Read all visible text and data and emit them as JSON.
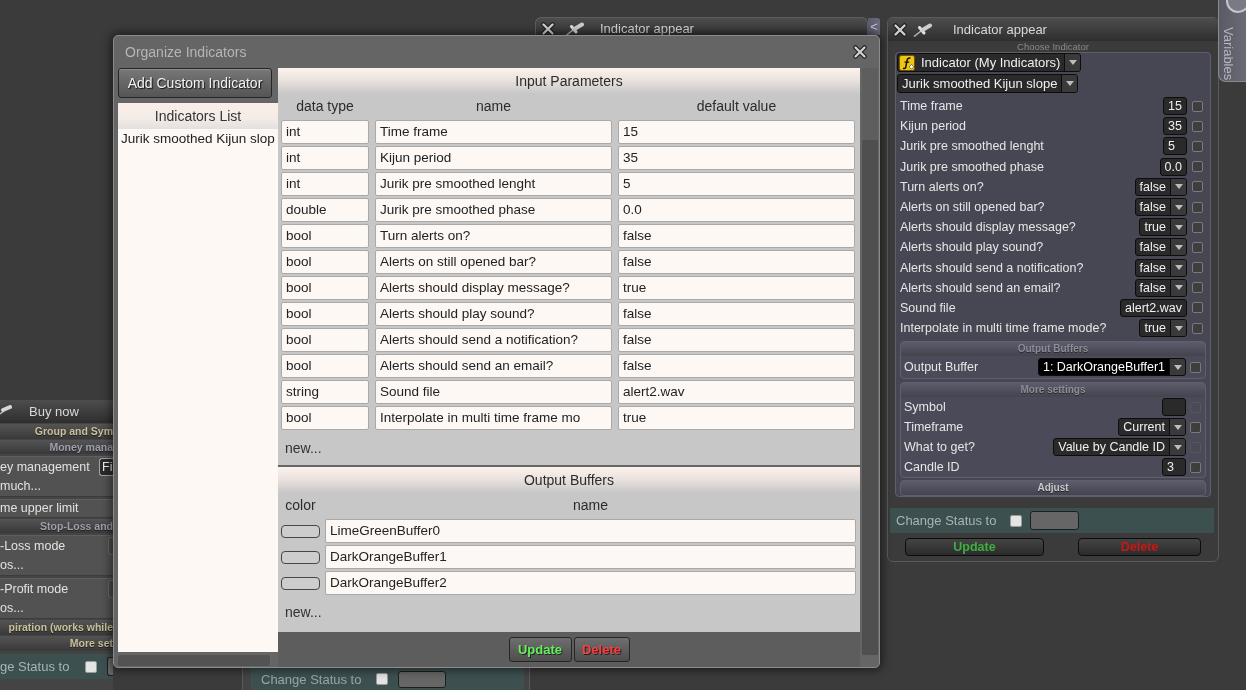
{
  "back_window": {
    "title": "Indicator appear",
    "collapse_tab": "<"
  },
  "side_tab": {
    "label": "Variables"
  },
  "left_window": {
    "title": "Buy now",
    "rows": [
      {
        "kind": "section",
        "text": "Group and Sym"
      },
      {
        "kind": "subsection",
        "text": "Money mana"
      },
      {
        "kind": "field",
        "label": "ey management",
        "value": "Fi",
        "subtext": "much..."
      },
      {
        "kind": "label",
        "label": "me upper limit"
      },
      {
        "kind": "subsection",
        "text": "Stop-Loss and"
      },
      {
        "kind": "field",
        "label": "-Loss mode",
        "subtext": "os..."
      },
      {
        "kind": "field",
        "label": "-Profit mode",
        "subtext": "os..."
      },
      {
        "kind": "section",
        "text": "piration (works while"
      },
      {
        "kind": "section",
        "text": "More set"
      }
    ],
    "status": {
      "label": "ge Status to",
      "checked": false
    }
  },
  "bottom_window": {
    "status": {
      "label": "Change Status to",
      "checked": false
    }
  },
  "dialog": {
    "title": "Organize Indicators",
    "add_button": "Add Custom Indicator",
    "list": {
      "title": "Indicators List",
      "items": [
        {
          "label": "Jurik smoothed Kijun slop"
        }
      ]
    },
    "inputs": {
      "title": "Input Parameters",
      "columns": [
        "data type",
        "name",
        "default value"
      ],
      "rows": [
        {
          "type": "int",
          "name": "Time frame",
          "value": "15"
        },
        {
          "type": "int",
          "name": "Kijun period",
          "value": "35"
        },
        {
          "type": "int",
          "name": "Jurik pre smoothed lenght",
          "value": "5"
        },
        {
          "type": "double",
          "name": "Jurik pre smoothed phase",
          "value": "0.0"
        },
        {
          "type": "bool",
          "name": "Turn alerts on?",
          "value": "false"
        },
        {
          "type": "bool",
          "name": "Alerts on still opened bar?",
          "value": "false"
        },
        {
          "type": "bool",
          "name": "Alerts should display message?",
          "value": "true"
        },
        {
          "type": "bool",
          "name": "Alerts should play sound?",
          "value": "false"
        },
        {
          "type": "bool",
          "name": "Alerts should send a notification?",
          "value": "false"
        },
        {
          "type": "bool",
          "name": "Alerts should send an email?",
          "value": "false"
        },
        {
          "type": "string",
          "name": "Sound file",
          "value": "alert2.wav"
        },
        {
          "type": "bool",
          "name": "Interpolate in multi time frame mo",
          "value": "true"
        }
      ],
      "new_label": "new..."
    },
    "outputs": {
      "title": "Output Buffers",
      "columns": [
        "color",
        "name"
      ],
      "rows": [
        {
          "name": "LimeGreenBuffer0"
        },
        {
          "name": "DarkOrangeBuffer1"
        },
        {
          "name": "DarkOrangeBuffer2"
        }
      ],
      "new_label": "new..."
    },
    "buttons": [
      {
        "kind": "update",
        "label": "Update"
      },
      {
        "kind": "delete",
        "label": "Delete"
      }
    ]
  },
  "indicator_window": {
    "title": "Indicator appear",
    "choose_label": "Choose Indicator",
    "indicator_select": "Indicator (My Indicators)",
    "name_select": "Jurik smoothed Kijun slope",
    "params": [
      {
        "label": "Time frame",
        "kind": "number",
        "value": "15",
        "checked": false
      },
      {
        "label": "Kijun period",
        "kind": "number",
        "value": "35",
        "checked": false
      },
      {
        "label": "Jurik pre smoothed lenght",
        "kind": "number",
        "value": "5",
        "checked": false
      },
      {
        "label": "Jurik pre smoothed phase",
        "kind": "number",
        "value": "0.0",
        "checked": false
      },
      {
        "label": "Turn alerts on?",
        "kind": "select",
        "value": "false",
        "checked": false
      },
      {
        "label": "Alerts on still opened bar?",
        "kind": "select",
        "value": "false",
        "checked": false
      },
      {
        "label": "Alerts should display message?",
        "kind": "select",
        "value": "true",
        "checked": false
      },
      {
        "label": "Alerts should play sound?",
        "kind": "select",
        "value": "false",
        "checked": false
      },
      {
        "label": "Alerts should send a notification?",
        "kind": "select",
        "value": "false",
        "checked": false
      },
      {
        "label": "Alerts should send an email?",
        "kind": "select",
        "value": "false",
        "checked": false
      },
      {
        "label": "Sound file",
        "kind": "text",
        "value": "alert2.wav",
        "checked": false
      },
      {
        "label": "Interpolate in multi time frame mode?",
        "kind": "select",
        "value": "true",
        "checked": false
      }
    ],
    "output_section": {
      "title": "Output Buffers",
      "rows": [
        {
          "label": "Output Buffer",
          "kind": "select",
          "value": "1: DarkOrangeBuffer1",
          "focused": true,
          "checked": false
        }
      ]
    },
    "more_section": {
      "title": "More settings",
      "rows": [
        {
          "label": "Symbol",
          "kind": "text",
          "checked": false,
          "enabled": false
        },
        {
          "label": "Timeframe",
          "kind": "select",
          "value": "Current",
          "checked": false,
          "enabled": true
        },
        {
          "label": "What to get?",
          "kind": "select",
          "value": "Value by Candle ID",
          "checked": false,
          "enabled": false
        },
        {
          "label": "Candle ID",
          "kind": "number",
          "value": "3",
          "checked": false,
          "enabled": true
        }
      ]
    },
    "adjust_label": "Adjust",
    "status": {
      "label": "Change Status to",
      "checked": false
    },
    "buttons": [
      {
        "kind": "update",
        "label": "Update"
      },
      {
        "kind": "delete",
        "label": "Delete"
      }
    ]
  }
}
